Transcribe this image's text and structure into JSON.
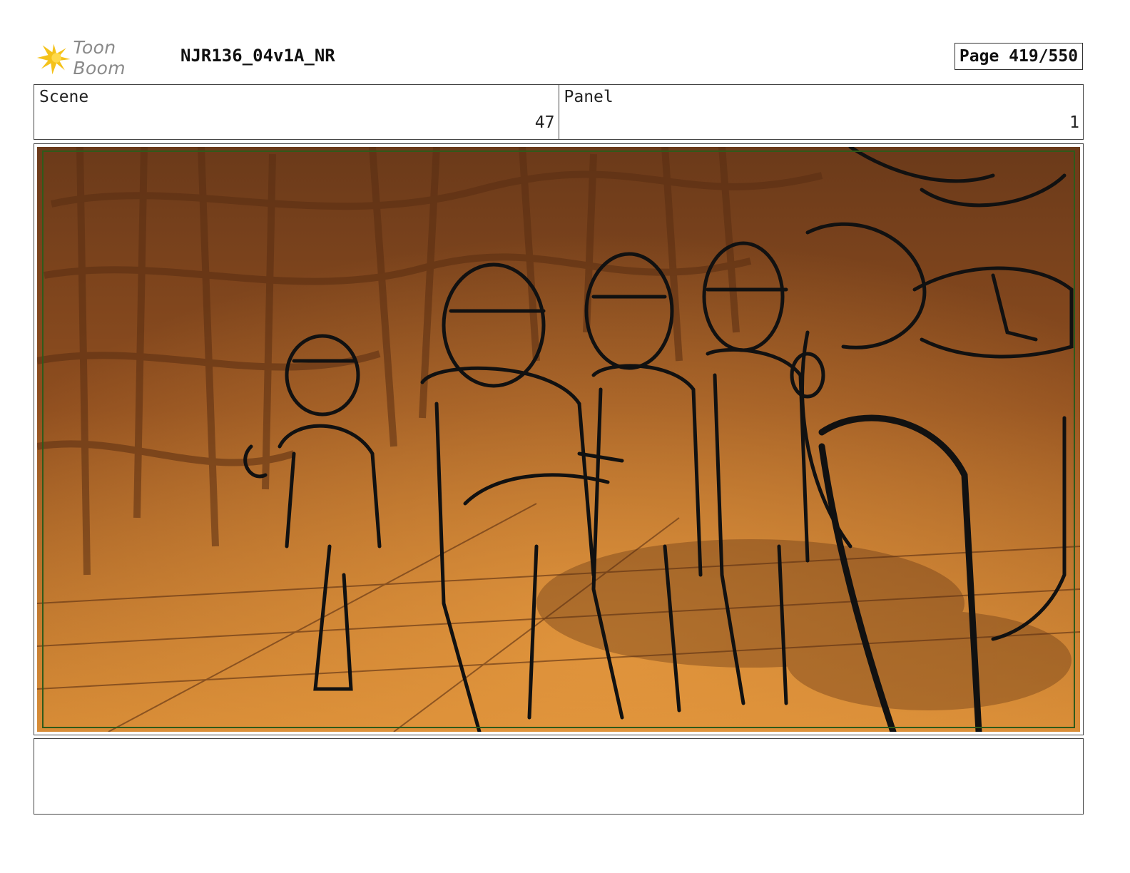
{
  "header": {
    "logo_text": "Toon Boom",
    "doc_title": "NJR136_04v1A_NR",
    "page_label": "Page 419/550"
  },
  "info": {
    "scene_label": "Scene",
    "scene_value": "47",
    "panel_label": "Panel",
    "panel_value": "1"
  },
  "panel": {
    "image_icon": "storyboard-sketch-image",
    "colors": {
      "background_light": "#d58a35",
      "background_dark": "#6b3a1a",
      "line": "#111111",
      "safe_frame": "#2f5a1a"
    }
  },
  "notes": {
    "text": ""
  }
}
